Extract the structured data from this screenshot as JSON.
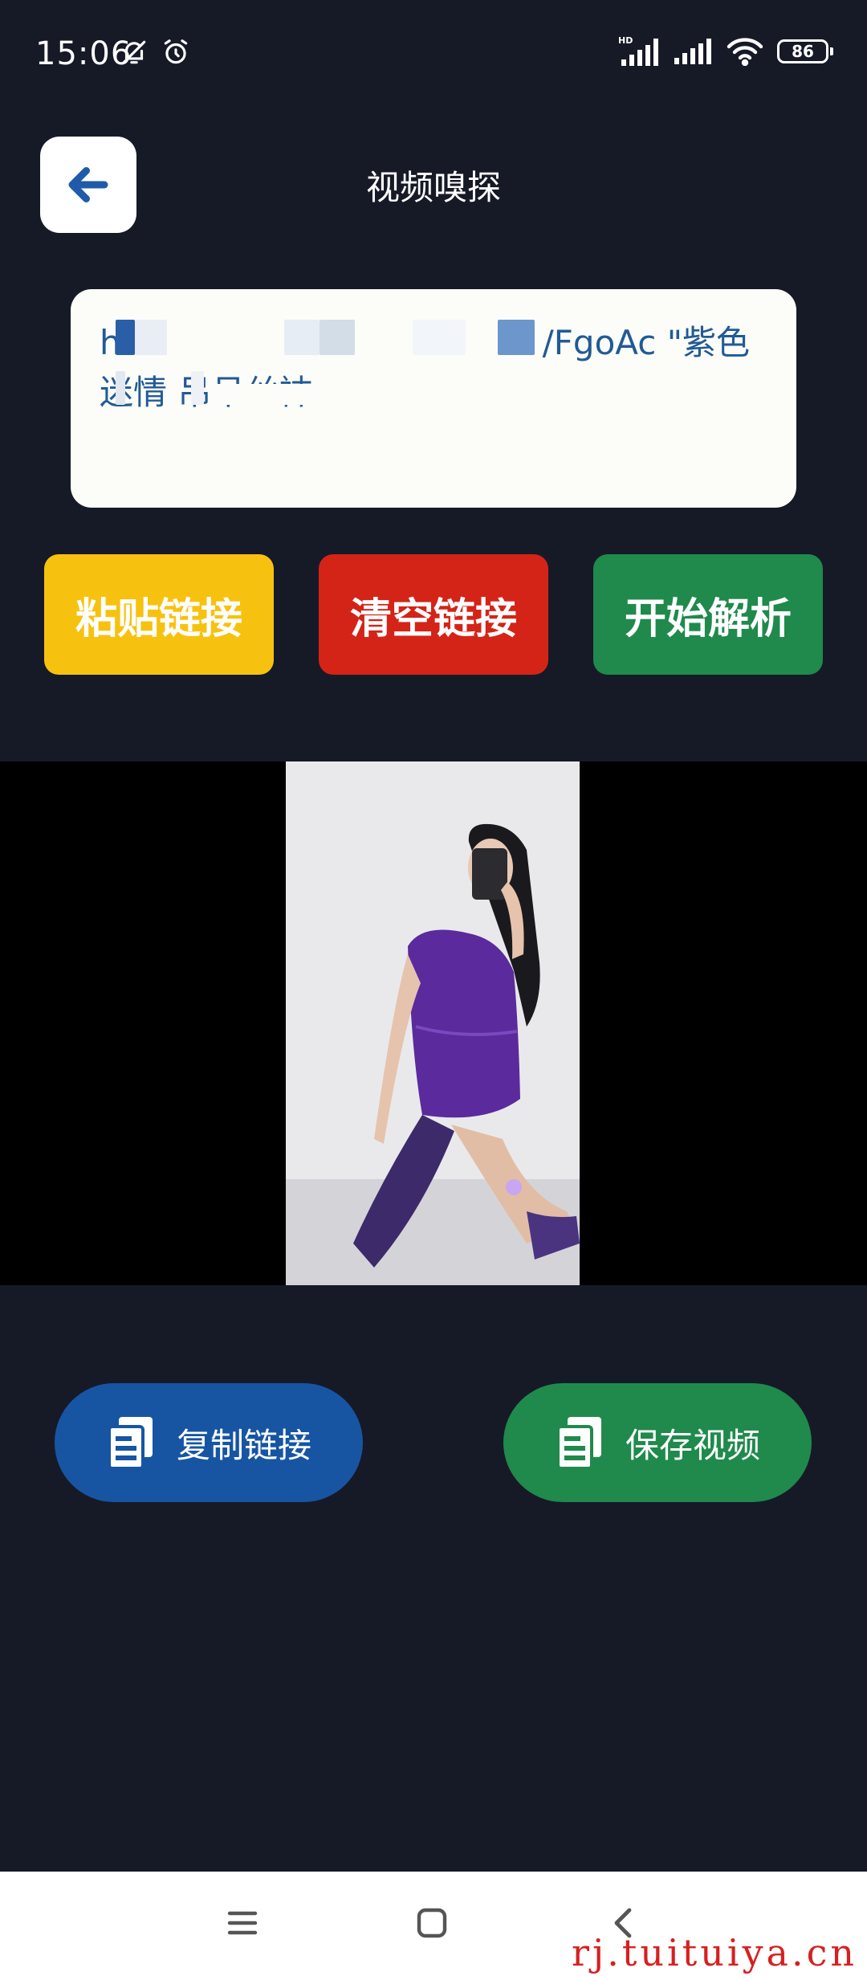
{
  "status_bar": {
    "time": "15:06",
    "battery": "86",
    "network_label": "HD",
    "icons": [
      "bell-off-icon",
      "alarm-icon",
      "signal-icon",
      "signal-icon",
      "wifi-icon",
      "battery-icon"
    ]
  },
  "header": {
    "title": "视频嗅探",
    "back_icon": "arrow-left-icon"
  },
  "link_input": {
    "value_start": "h",
    "value_end": "/FgoAc \"紫色",
    "value_line2": "迷情  吊吊丝袜"
  },
  "actions": {
    "paste_label": "粘贴链接",
    "clear_label": "清空链接",
    "parse_label": "开始解析"
  },
  "results": {
    "copy_label": "复制链接",
    "save_label": "保存视频",
    "copy_icon": "copy-icon",
    "save_icon": "copy-icon"
  },
  "nav": {
    "icons": [
      "menu-icon",
      "home-icon",
      "back-icon"
    ]
  },
  "watermark": "rj.tuituiya.cn",
  "colors": {
    "background": "#161a27",
    "paste": "#f7c20f",
    "clear": "#d42418",
    "parse": "#1f8a4c",
    "copy": "#1755a3",
    "save": "#1f8a4c",
    "accent_text": "#215a96"
  }
}
